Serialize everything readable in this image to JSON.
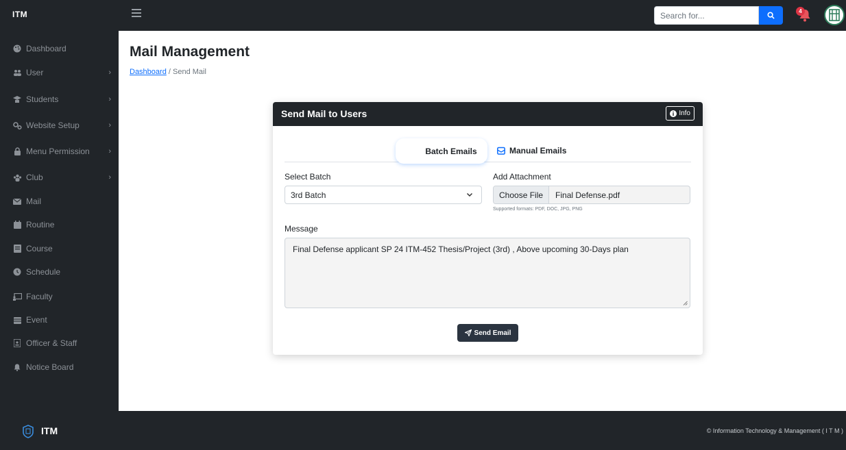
{
  "app": {
    "brand": "ITM",
    "footer_brand": "ITM",
    "footer_copyright": "© Information Technology & Management ( I T M )"
  },
  "topbar": {
    "search_placeholder": "Search for...",
    "notification_count": "4"
  },
  "sidebar": {
    "items": [
      {
        "label": "Dashboard",
        "icon": "palette-icon",
        "has_submenu": false
      },
      {
        "label": "User",
        "icon": "users-icon",
        "has_submenu": true
      },
      {
        "label": "Students",
        "icon": "graduate-icon",
        "has_submenu": true
      },
      {
        "label": "Website Setup",
        "icon": "gears-icon",
        "has_submenu": true
      },
      {
        "label": "Menu Permission",
        "icon": "lock-icon",
        "has_submenu": true
      },
      {
        "label": "Club",
        "icon": "people-group-icon",
        "has_submenu": true
      },
      {
        "label": "Mail",
        "icon": "envelope-icon",
        "has_submenu": false
      },
      {
        "label": "Routine",
        "icon": "calendar-icon",
        "has_submenu": false
      },
      {
        "label": "Course",
        "icon": "book-icon",
        "has_submenu": false
      },
      {
        "label": "Schedule",
        "icon": "clock-icon",
        "has_submenu": false
      },
      {
        "label": "Faculty",
        "icon": "chalkboard-icon",
        "has_submenu": false
      },
      {
        "label": "Event",
        "icon": "calendar-event-icon",
        "has_submenu": false
      },
      {
        "label": "Officer & Staff",
        "icon": "id-badge-icon",
        "has_submenu": false
      },
      {
        "label": "Notice Board",
        "icon": "bell-icon",
        "has_submenu": false
      }
    ]
  },
  "main": {
    "title": "Mail Management",
    "breadcrumb": {
      "home": "Dashboard",
      "separator": "/",
      "current": "Send Mail"
    }
  },
  "card": {
    "title": "Send Mail to Users",
    "info_label": "Info",
    "tabs": {
      "batch": "Batch Emails",
      "manual": "Manual Emails"
    },
    "select_batch": {
      "label": "Select Batch",
      "value": "3rd Batch"
    },
    "attachment": {
      "label": "Add Attachment",
      "button": "Choose File",
      "file_name": "Final Defense.pdf",
      "hint": "Supported formats: PDF, DOC, JPG, PNG"
    },
    "message": {
      "label": "Message",
      "value": "Final Defense applicant SP 24 ITM-452 Thesis/Project (3rd) , Above upcoming 30-Days plan"
    },
    "send_label": "Send Email"
  },
  "colors": {
    "dark": "#212529",
    "primary": "#0d6efd",
    "danger": "#dc3545",
    "sidebar_text": "#8c9197"
  }
}
